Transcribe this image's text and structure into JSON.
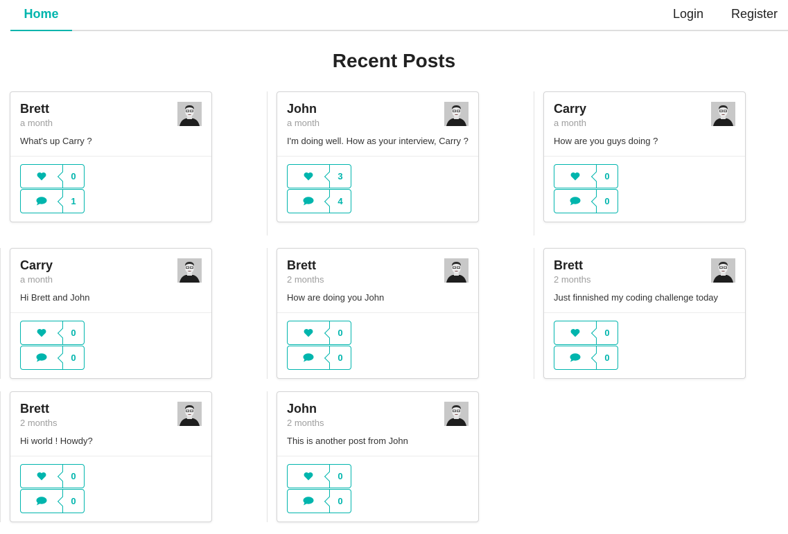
{
  "nav": {
    "home": "Home",
    "login": "Login",
    "register": "Register"
  },
  "page_title": "Recent Posts",
  "colors": {
    "accent": "#00b5ad"
  },
  "posts": [
    {
      "author": "Brett",
      "time": "a month",
      "text": "What's up Carry ?",
      "likes": "0",
      "comments": "1"
    },
    {
      "author": "John",
      "time": "a month",
      "text": "I'm doing well. How as your interview, Carry ?",
      "likes": "3",
      "comments": "4"
    },
    {
      "author": "Carry",
      "time": "a month",
      "text": "How are you guys doing ?",
      "likes": "0",
      "comments": "0"
    },
    {
      "author": "Carry",
      "time": "a month",
      "text": "Hi Brett and John",
      "likes": "0",
      "comments": "0"
    },
    {
      "author": "Brett",
      "time": "2 months",
      "text": "How are doing you John",
      "likes": "0",
      "comments": "0"
    },
    {
      "author": "Brett",
      "time": "2 months",
      "text": "Just finnished my coding challenge today",
      "likes": "0",
      "comments": "0"
    },
    {
      "author": "Brett",
      "time": "2 months",
      "text": "Hi world ! Howdy?",
      "likes": "0",
      "comments": "0"
    },
    {
      "author": "John",
      "time": "2 months",
      "text": "This is another post from John",
      "likes": "0",
      "comments": "0"
    }
  ],
  "icons": {
    "like": "heart-icon",
    "comment": "comment-icon",
    "avatar": "user-avatar"
  }
}
